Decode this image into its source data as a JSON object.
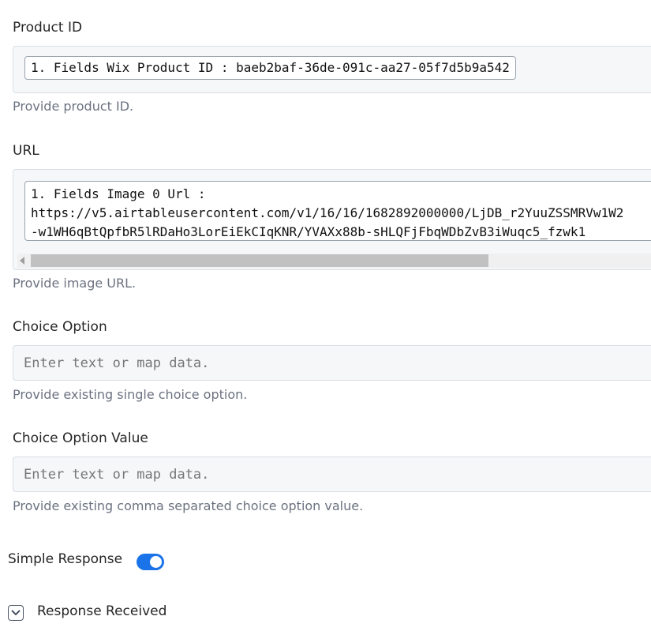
{
  "product_id": {
    "label": "Product ID",
    "value": "1. Fields Wix Product ID : baeb2baf-36de-091c-aa27-05f7d5b9a542",
    "help": "Provide product ID."
  },
  "url": {
    "label": "URL",
    "value_line1": "1. Fields Image 0 Url :",
    "value_line2": "https://v5.airtableusercontent.com/v1/16/16/1682892000000/LjDB_r2YuuZSSMRVw1W2",
    "value_line3": "-w1WH6qBtQpfbR5lRDaHo3LorEiEkCIqKNR/YVAXx88b-sHLQFjFbqWDbZvB3iWuqc5_fzwk1",
    "help": "Provide image URL."
  },
  "choice_option": {
    "label": "Choice Option",
    "placeholder": "Enter text or map data.",
    "help": "Provide existing single choice option."
  },
  "choice_option_value": {
    "label": "Choice Option Value",
    "placeholder": "Enter text or map data.",
    "help": "Provide existing comma separated choice option value."
  },
  "simple_response": {
    "label": "Simple Response",
    "enabled": true,
    "accent": "#1a73e8"
  },
  "response_received": {
    "label": "Response Received",
    "icon": "chevron-down-icon"
  }
}
